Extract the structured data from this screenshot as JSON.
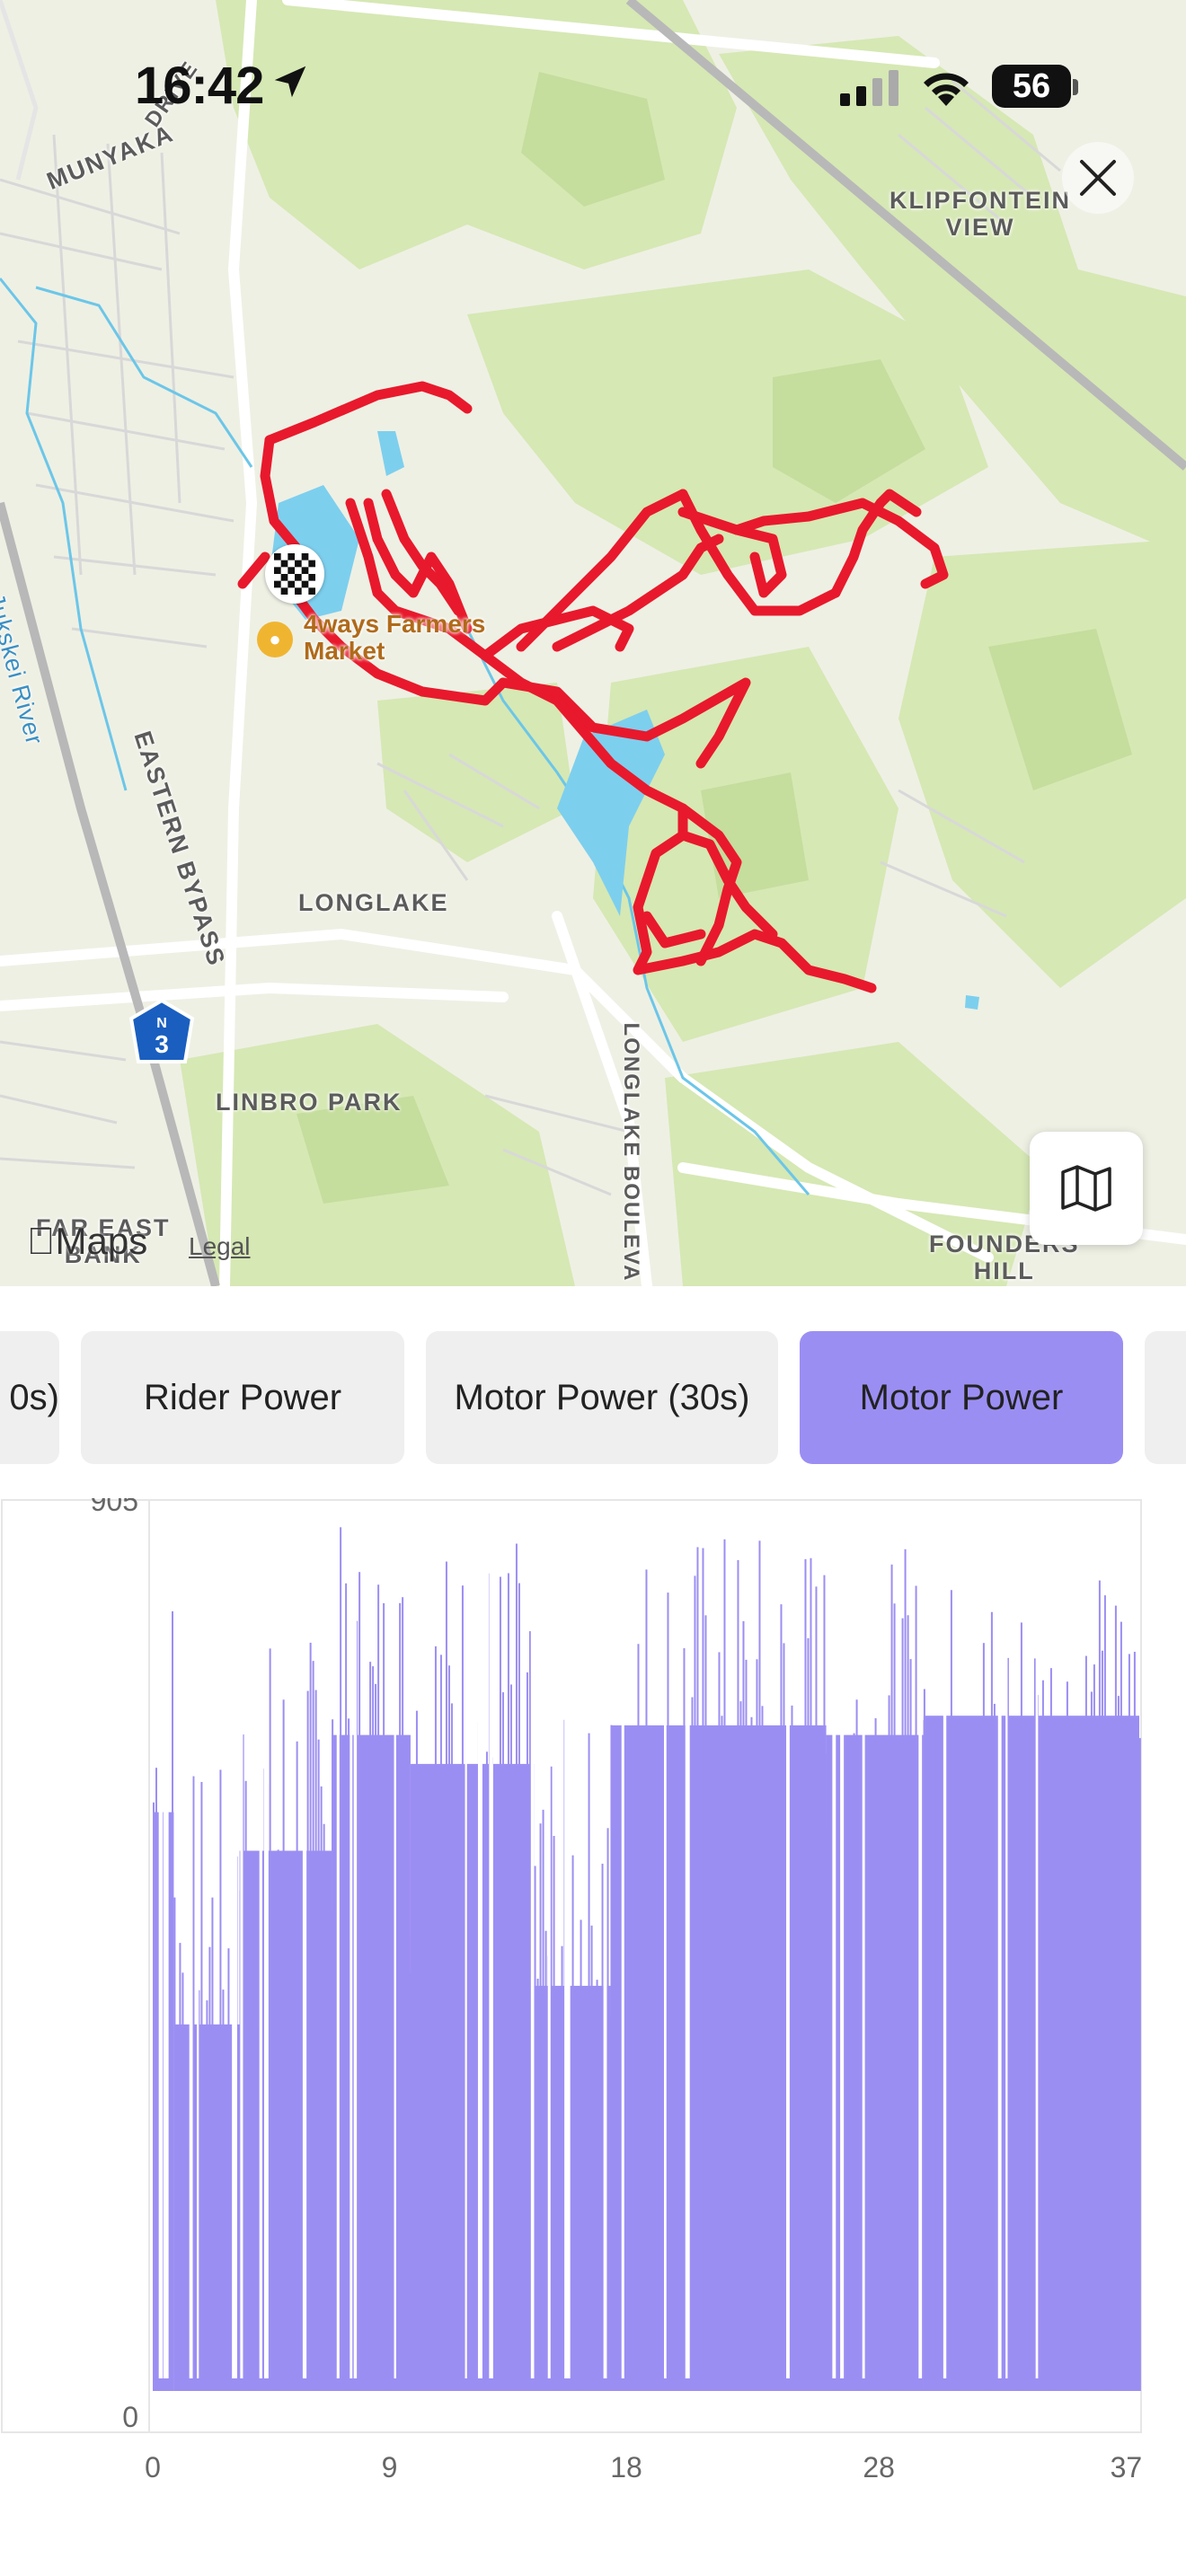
{
  "status_bar": {
    "time": "16:42",
    "battery": "56"
  },
  "map": {
    "labels": {
      "munyaka": "MUNYAKA",
      "drive": "DRIVE",
      "klipfontein_1": "KLIPFONTEIN",
      "klipfontein_2": "VIEW",
      "jukskei": "Jukskei River",
      "eastern_bypass": "EASTERN BYPASS",
      "longlake": "LONGLAKE",
      "linbro_park": "LINBRO PARK",
      "longlake_boulevard": "LONGLAKE BOULEVA",
      "far_east_bank_1": "FAR EAST",
      "far_east_bank_2": "BANK",
      "founders_hill_1": "FOUNDERS",
      "founders_hill_2": "HILL",
      "route_shield_top": "N",
      "route_shield_num": "3"
    },
    "poi": {
      "line1": "4ways Farmers",
      "line2": "Market"
    },
    "attribution": {
      "maps": "Maps",
      "legal": "Legal"
    },
    "route_color": "#e8192c"
  },
  "tabs": [
    {
      "label": "0s)",
      "active": false
    },
    {
      "label": "Rider Power",
      "active": false
    },
    {
      "label": "Motor Power (30s)",
      "active": false
    },
    {
      "label": "Motor Power",
      "active": true
    },
    {
      "label": "",
      "active": false
    }
  ],
  "accent_color": "#9b8ef3",
  "chart_data": {
    "type": "bar",
    "series": [
      {
        "name": "Motor Power"
      }
    ],
    "ylim": [
      0,
      905
    ],
    "y_ticks": [
      "905",
      "0"
    ],
    "x_ticks": [
      "0",
      "9",
      "18",
      "28",
      "37"
    ],
    "xlim": [
      0,
      37.5
    ],
    "segments": [
      {
        "x": [
          0.0,
          0.8
        ],
        "peak": 870,
        "fill_level": 600
      },
      {
        "x": [
          0.8,
          3.3
        ],
        "peak": 650,
        "fill_level": 380
      },
      {
        "x": [
          3.3,
          6.8
        ],
        "peak": 790,
        "fill_level": 560
      },
      {
        "x": [
          6.8,
          9.8
        ],
        "peak": 900,
        "fill_level": 680
      },
      {
        "x": [
          9.8,
          14.5
        ],
        "peak": 895,
        "fill_level": 650
      },
      {
        "x": [
          14.5,
          17.4
        ],
        "peak": 700,
        "fill_level": 420
      },
      {
        "x": [
          17.4,
          25.6
        ],
        "peak": 900,
        "fill_level": 690
      },
      {
        "x": [
          25.6,
          29.3
        ],
        "peak": 875,
        "fill_level": 680
      },
      {
        "x": [
          29.3,
          37.5
        ],
        "peak": 855,
        "fill_level": 700
      }
    ]
  }
}
